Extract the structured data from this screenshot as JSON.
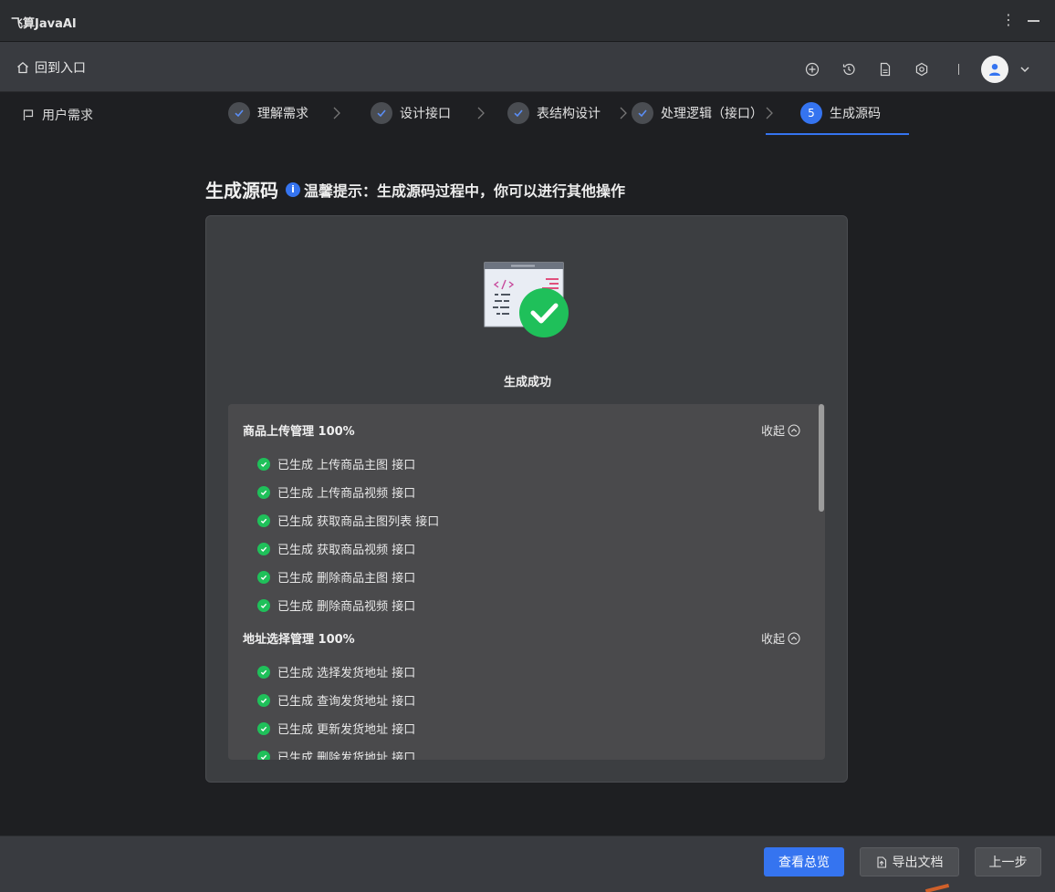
{
  "app": {
    "title": "飞算JavaAI"
  },
  "nav": {
    "home_label": "回到入口"
  },
  "req": {
    "label": "用户需求"
  },
  "steps": [
    {
      "label": "理解需求",
      "state": "done"
    },
    {
      "label": "设计接口",
      "state": "done"
    },
    {
      "label": "表结构设计",
      "state": "done"
    },
    {
      "label": "处理逻辑（接口）",
      "state": "done"
    },
    {
      "label": "生成源码",
      "state": "active",
      "number": "5"
    }
  ],
  "page": {
    "title": "生成源码",
    "tip": "温馨提示：生成源码过程中，你可以进行其他操作",
    "status": "生成成功"
  },
  "groups": [
    {
      "title": "商品上传管理 100%",
      "collapse_label": "收起",
      "items": [
        "已生成 上传商品主图 接口",
        "已生成 上传商品视频 接口",
        "已生成 获取商品主图列表 接口",
        "已生成 获取商品视频 接口",
        "已生成 删除商品主图 接口",
        "已生成 删除商品视频 接口"
      ]
    },
    {
      "title": "地址选择管理 100%",
      "collapse_label": "收起",
      "items": [
        "已生成 选择发货地址 接口",
        "已生成 查询发货地址 接口",
        "已生成 更新发货地址 接口",
        "已生成 删除发货地址 接口"
      ]
    }
  ],
  "footer": {
    "overview_label": "查看总览",
    "export_label": "导出文档",
    "prev_label": "上一步"
  },
  "colors": {
    "accent": "#3574f0",
    "success": "#1fc05a",
    "bg": "#1e1f22",
    "panel": "#3c3e41"
  }
}
